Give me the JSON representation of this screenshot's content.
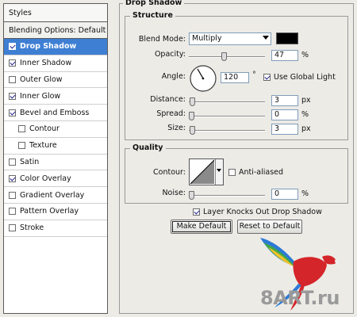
{
  "styles_panel": {
    "header": "Styles",
    "blending_options": "Blending Options: Default",
    "items": [
      {
        "label": "Drop Shadow",
        "checked": true,
        "selected": true,
        "sub": false
      },
      {
        "label": "Inner Shadow",
        "checked": true,
        "selected": false,
        "sub": false
      },
      {
        "label": "Outer Glow",
        "checked": false,
        "selected": false,
        "sub": false
      },
      {
        "label": "Inner Glow",
        "checked": true,
        "selected": false,
        "sub": false
      },
      {
        "label": "Bevel and Emboss",
        "checked": true,
        "selected": false,
        "sub": false
      },
      {
        "label": "Contour",
        "checked": false,
        "selected": false,
        "sub": true
      },
      {
        "label": "Texture",
        "checked": false,
        "selected": false,
        "sub": true
      },
      {
        "label": "Satin",
        "checked": false,
        "selected": false,
        "sub": false
      },
      {
        "label": "Color Overlay",
        "checked": true,
        "selected": false,
        "sub": false
      },
      {
        "label": "Gradient Overlay",
        "checked": false,
        "selected": false,
        "sub": false
      },
      {
        "label": "Pattern Overlay",
        "checked": false,
        "selected": false,
        "sub": false
      },
      {
        "label": "Stroke",
        "checked": false,
        "selected": false,
        "sub": false
      }
    ]
  },
  "drop_shadow": {
    "title": "Drop Shadow",
    "structure": {
      "title": "Structure",
      "blend_mode_label": "Blend Mode:",
      "blend_mode_value": "Multiply",
      "shadow_color": "#000000",
      "opacity_label": "Opacity:",
      "opacity_value": "47",
      "opacity_unit": "%",
      "opacity_fraction": 0.47,
      "angle_label": "Angle:",
      "angle_value": "120",
      "angle_unit": "°",
      "angle_degrees": 120,
      "use_global_light_label": "Use Global Light",
      "use_global_light_checked": true,
      "distance_label": "Distance:",
      "distance_value": "3",
      "distance_unit": "px",
      "distance_fraction": 0.012,
      "spread_label": "Spread:",
      "spread_value": "0",
      "spread_unit": "%",
      "spread_fraction": 0.0,
      "size_label": "Size:",
      "size_value": "3",
      "size_unit": "px",
      "size_fraction": 0.012
    },
    "quality": {
      "title": "Quality",
      "contour_label": "Contour:",
      "anti_aliased_label": "Anti-aliased",
      "anti_aliased_checked": false,
      "noise_label": "Noise:",
      "noise_value": "0",
      "noise_unit": "%",
      "noise_fraction": 0.0
    },
    "layer_knocks_out_label": "Layer Knocks Out Drop Shadow",
    "layer_knocks_out_checked": true,
    "make_default_label": "Make Default",
    "reset_default_label": "Reset to Default"
  },
  "watermark": {
    "text": "8ART.ru"
  }
}
